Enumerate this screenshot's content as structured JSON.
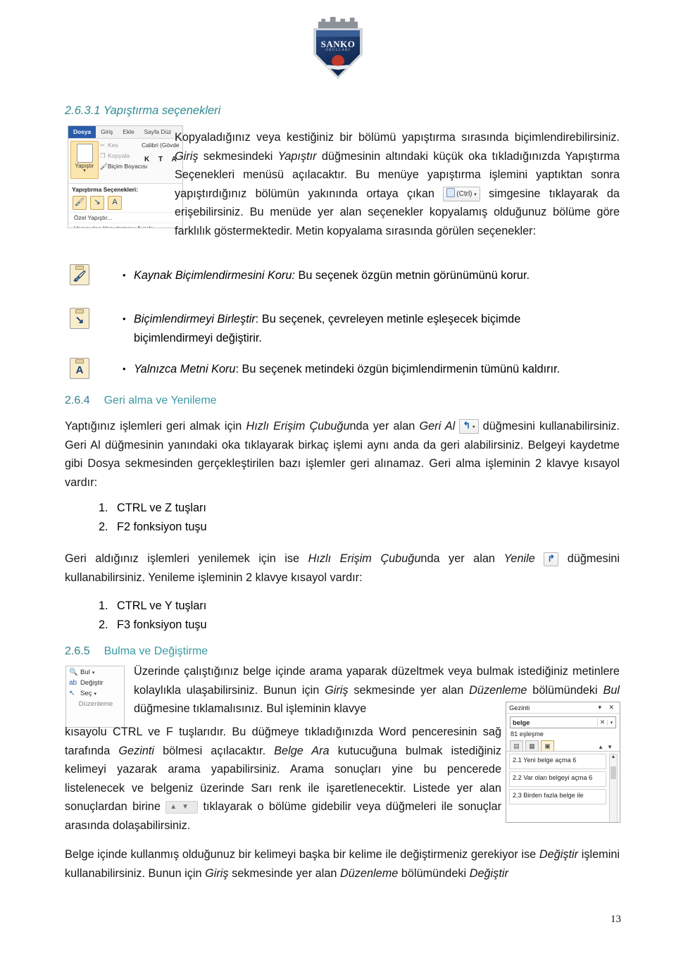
{
  "logo": {
    "name": "SANKO",
    "subtitle": "OKULLARI"
  },
  "headings": {
    "sec_2631": "2.6.3.1 Yapıştırma seçenekleri",
    "sec_264_num": "2.6.4",
    "sec_264_title": "Geri alma ve Yenileme",
    "sec_265_num": "2.6.5",
    "sec_265_title": "Bulma ve Değiştirme"
  },
  "paste_ribbon": {
    "tabs": [
      "Dosya",
      "Giriş",
      "Ekle",
      "Sayfa Düz"
    ],
    "active_tab": "Dosya",
    "paste_button": "Yapıştır",
    "commands": [
      "Kes",
      "Kopyala",
      "Biçim Boyacısı"
    ],
    "font_name": "Calibri (Gövde",
    "format_buttons": "K T A",
    "menu_title": "Yapıştırma Seçenekleri:",
    "menu_items": [
      "Özel Yapıştır...",
      "Varsayılan Yapıştırmayı Ayarla..."
    ],
    "option_icons": [
      "keep-source-formatting",
      "merge-formatting",
      "keep-text-only"
    ]
  },
  "body": {
    "p1_a": "Kopyaladığınız veya kestiğiniz bir bölümü yapıştırma sırasında biçimlendirebilirsiniz. ",
    "p1_giris": "Giriş",
    "p1_b": " sekmesindeki ",
    "p1_yapistir": "Yapıştır",
    "p1_c": " düğmesinin altındaki küçük oka tıkladığınızda Yapıştırma Seçenekleri menüsü açılacaktır. Bu menüye yapıştırma işlemini yaptıktan sonra yapıştırdığınız bölümün yakınında ortaya çıkan ",
    "p1_ctrl_btn": "(Ctrl)",
    "p1_d": " simgesine tıklayarak da erişebilirsiniz. Bu menüde yer alan seçenekler kopyalamış olduğunuz bölüme göre farklılık göstermektedir. Metin kopyalama sırasında görülen seçenekler:",
    "b1_title": "Kaynak Biçimlendirmesini Koru:",
    "b1_text": " Bu seçenek özgün metnin görünümünü korur.",
    "b2_title": "Biçimlendirmeyi Birleştir",
    "b2_text": ": Bu seçenek, çevreleyen metinle eşleşecek biçimde biçimlendirmeyi değiştirir.",
    "b3_title": "Yalnızca Metni Koru",
    "b3_text": ": Bu seçenek metindeki özgün biçimlendirmenin tümünü kaldırır.",
    "p2_a": "Yaptığınız işlemleri geri almak için ",
    "p2_hizli": "Hızlı Erişim Çubuğu",
    "p2_b": "nda yer alan ",
    "p2_gerial": "Geri Al",
    "p2_c": " düğmesini kullanabilirsiniz. Geri Al düğmesinin yanındaki oka tıklayarak birkaç işlemi aynı anda da geri alabilirsiniz. Belgeyi kaydetme gibi Dosya sekmesinden gerçekleştirilen bazı işlemler geri alınamaz. Geri alma işleminin 2 klavye kısayol vardır:",
    "list1": [
      "CTRL ve Z tuşları",
      "F2 fonksiyon tuşu"
    ],
    "p3_a": "Geri aldığınız işlemleri yenilemek için ise ",
    "p3_hizli": "Hızlı Erişim Çubuğu",
    "p3_b": "nda yer alan ",
    "p3_yenile": "Yenile",
    "p3_c": " düğmesini kullanabilirsiniz. Yenileme işleminin 2 klavye kısayol vardır:",
    "list2": [
      "CTRL ve Y tuşları",
      "F3 fonksiyon tuşu"
    ],
    "p4_a": "Üzerinde çalıştığınız belge içinde arama yaparak düzeltmek veya bulmak istediğiniz metinlere kolaylıkla ulaşabilirsiniz. Bunun için ",
    "p4_giris": "Giriş",
    "p4_b": " sekmesinde yer alan ",
    "p4_duzenleme": "Düzenleme",
    "p4_c": " bölümündeki ",
    "p4_bul": "Bul",
    "p4_d": " düğmesine tıklamalısınız. Bul işleminin klavye",
    "p5_a": "kısayolu CTRL ve F tuşlarıdır. Bu düğmeye tıkladığınızda Word penceresinin sağ tarafında ",
    "p5_gezinti": "Gezinti",
    "p5_b": " bölmesi açılacaktır. ",
    "p5_belgeara": "Belge Ara",
    "p5_c": " kutucuğuna bulmak istediğiniz kelimeyi yazarak arama yapabilirsiniz. Arama sonuçları yine bu pencerede listelenecek ve belgeniz üzerinde Sarı renk ile işaretlenecektir. Listede yer alan sonuçlardan birine ",
    "p5_d": " tıklayarak o bölüme gidebilir veya düğmeleri ile sonuçlar arasında dolaşabilirsiniz.",
    "p6_a": "Belge içinde kullanmış olduğunuz bir kelimeyi başka bir kelime ile değiştirmeniz gerekiyor ise ",
    "p6_degistir1": "Değiştir",
    "p6_b": " işlemini kullanabilirsiniz. Bunun için ",
    "p6_giris": "Giriş",
    "p6_c": " sekmesinde yer alan ",
    "p6_duzenleme": "Düzenleme",
    "p6_d": " bölümündeki ",
    "p6_degistir2": "Değiştir"
  },
  "find_ribbon": {
    "items": [
      "Bul",
      "Değiştir",
      "Seç"
    ],
    "group_label": "Düzenleme"
  },
  "nav_pane": {
    "title": "Gezinti",
    "search_value": "belge",
    "match_count": "81 eşleşme",
    "results": [
      "2.1 Yeni belge açma 6",
      "2.2 Var olan belgeyi açma 6",
      "2.3 Birden fazla belge ile"
    ],
    "result_highlight": "belge"
  },
  "footer": {
    "page_number": "13"
  },
  "colors": {
    "heading": "#2e8b94",
    "subheading": "#3a9aa4",
    "ribbon_active_tab": "#2a5caa",
    "paste_highlight": "#fbe6b0"
  }
}
